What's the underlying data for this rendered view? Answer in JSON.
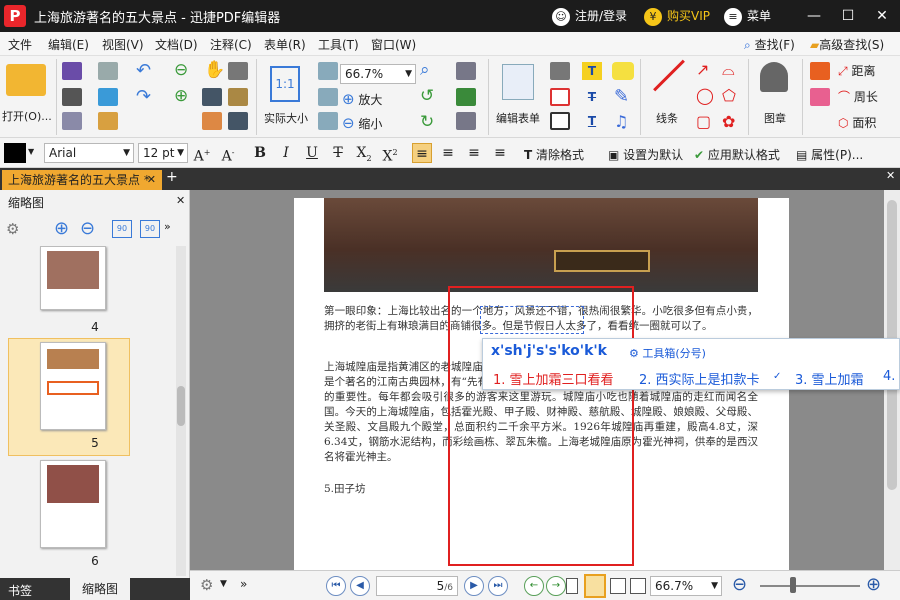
{
  "window": {
    "title": "上海旅游著名的五大景点 - 迅捷PDF编辑器",
    "logo": "P",
    "login": "注册/登录",
    "vip": "购买VIP",
    "menu": "菜单"
  },
  "menubar": {
    "items": [
      "文件",
      "编辑(E)",
      "视图(V)",
      "文档(D)",
      "注释(C)",
      "表单(R)",
      "工具(T)",
      "窗口(W)"
    ],
    "right": [
      "查找(F)",
      "高级查找(S)"
    ]
  },
  "ribbon": {
    "open": "打开(O)...",
    "actual_size": "实际大小",
    "zoom": "66.7%",
    "zoom_in": "放大",
    "zoom_out": "缩小",
    "edit_form": "编辑表单",
    "lines": "线条",
    "stamp": "图章",
    "distance": "距离",
    "perimeter": "周长",
    "area": "面积"
  },
  "format": {
    "font": "Arial",
    "size": "12 pt",
    "clear": "清除格式",
    "set_default": "设置为默认",
    "apply_default": "应用默认格式",
    "props": "属性(P)..."
  },
  "tabs": {
    "doc": "上海旅游著名的五大景点 *"
  },
  "sidebar": {
    "title": "缩略图",
    "pages": [
      "4",
      "5",
      "6"
    ],
    "bottom_tabs": [
      "书签",
      "缩略图"
    ]
  },
  "page": {
    "p1": "第一眼印象：上海比较出名的一个地方，风景还不错，很热闹很繁华。小吃很多但有点小贵，拥挤的老街上有琳琅满目的商铺很多。但是节假日人太多了，看看统一圈就可以了。",
    "p2": "上海城隍庙是指黄浦区的老城隍庙，位于上海市黄浦区方浜中路，是上海的一座道教宫观，这是个著名的江南古典园林，有“先有城隍庙，后有上海滩”之说，可以看出在当时上海人心中它的重要性。每年都会吸引很多的游客来这里游玩。城隍庙小吃也随着城隍庙的走红而闻名全国。今天的上海城隍庙，包括霍光殿、甲子殿、财神殿、慈航殿、城隍殿、娘娘殿、父母殿、关圣殿、文昌殿九个殿堂，总面积约二千余平方米。1926年城隍庙再重建，殿高4.8丈，深6.34丈，钢筋水泥结构，而彩绘画栋、翠瓦朱檐。上海老城隍庙原为霍光神祠，供奉的是西汉名将霍光神主。",
    "p3": "5.田子坊"
  },
  "ime": {
    "composition": "x'sh'j's's'ko'k'k",
    "toolbox": "工具箱(分号)",
    "candidates": [
      "1. 雪上加霜三口看看",
      "2. 西实际上是扣款卡",
      "3. 雪上加霜",
      "4."
    ]
  },
  "status": {
    "page": "5",
    "total": "/6",
    "zoom": "66.7%"
  },
  "colors": {
    "accent": "#f0a830",
    "titlebar": "#1c1c1c",
    "red": "#e02020",
    "blue": "#2a6ad8"
  }
}
